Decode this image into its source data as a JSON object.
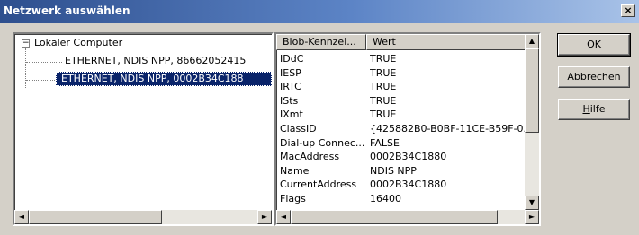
{
  "window": {
    "title": "Netzwerk auswählen",
    "close_glyph": "×"
  },
  "tree": {
    "root_label": "Lokaler Computer",
    "expander_glyph": "−",
    "items": [
      {
        "label": "ETHERNET, NDIS NPP, 86662052415"
      },
      {
        "label": "ETHERNET, NDIS NPP, 0002B34C188"
      }
    ],
    "selected_index": 1
  },
  "properties": {
    "columns": [
      "Blob-Kennzei...",
      "Wert"
    ],
    "rows": [
      {
        "name": "IDdC",
        "value": "TRUE"
      },
      {
        "name": "IESP",
        "value": "TRUE"
      },
      {
        "name": "IRTC",
        "value": "TRUE"
      },
      {
        "name": "ISts",
        "value": "TRUE"
      },
      {
        "name": "IXmt",
        "value": "TRUE"
      },
      {
        "name": "ClassID",
        "value": "{425882B0-B0BF-11CE-B59F-0..."
      },
      {
        "name": "Dial-up Connec...",
        "value": "FALSE"
      },
      {
        "name": "MacAddress",
        "value": "0002B34C1880"
      },
      {
        "name": "Name",
        "value": "NDIS NPP"
      },
      {
        "name": "CurrentAddress",
        "value": "0002B34C1880"
      },
      {
        "name": "Flags",
        "value": "16400"
      }
    ]
  },
  "buttons": {
    "ok": "OK",
    "cancel": "Abbrechen",
    "help_prefix": "",
    "help_underlined": "H",
    "help_rest": "ilfe"
  },
  "scroll": {
    "left": "◄",
    "right": "►",
    "up": "▲",
    "down": "▼"
  }
}
